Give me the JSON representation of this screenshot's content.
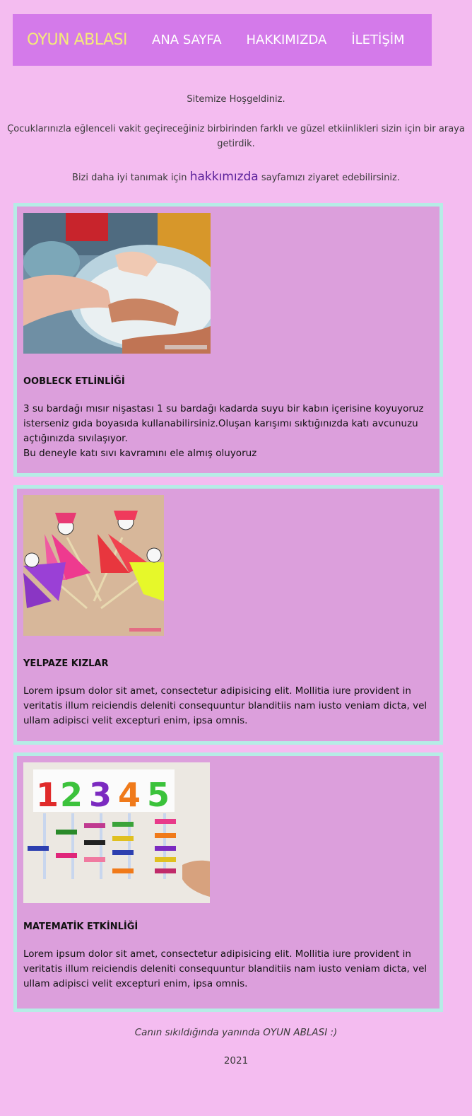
{
  "nav": {
    "brand": "OYUN ABLASI",
    "links": [
      "ANA SAYFA",
      "HAKKIMIZDA",
      "İLETİŞİM"
    ]
  },
  "intro": {
    "welcome": "Sitemize Hoşgeldiniz.",
    "description": "Çocuklarınızla eğlenceli vakit geçireceğiniz birbirinden farklı ve güzel etkiinlikleri sizin için bir araya getirdik.",
    "about_prefix": "Bizi daha iyi tanımak için",
    "about_link": "hakkımızda",
    "about_suffix": "sayfamızı ziyaret edebilirsiniz."
  },
  "activities": [
    {
      "title": "OOBLECK ETLİNLİĞİ",
      "text": "3 su bardağı mısır nişastası 1 su bardağı kadarda suyu bir kabın içerisine koyuyoruz isterseniz gıda boyasıda kullanabilirsiniz.Oluşan karışımı sıktığınızda katı avcunuzu açtığınızda sıvılaşıyor.",
      "text2": "Bu deneyle katı sıvı kavramını ele almış oluyoruz"
    },
    {
      "title": "YELPAZE KIZLAR",
      "text": "Lorem ipsum dolor sit amet, consectetur adipisicing elit. Mollitia iure provident in veritatis illum reiciendis deleniti consequuntur blanditiis nam iusto veniam dicta, vel ullam adipisci velit excepturi enim, ipsa omnis."
    },
    {
      "title": "MATEMATİK ETKİNLİĞİ",
      "text": "Lorem ipsum dolor sit amet, consectetur adipisicing elit. Mollitia iure provident in veritatis illum reiciendis deleniti consequuntur blanditiis nam iusto veniam dicta, vel ullam adipisci velit excepturi enim, ipsa omnis.",
      "photo_digits": [
        "1",
        "2",
        "3",
        "4",
        "5"
      ]
    }
  ],
  "footer": {
    "tagline": "Canın sıkıldığında yanında OYUN ABLASI :)",
    "year": "2021"
  }
}
